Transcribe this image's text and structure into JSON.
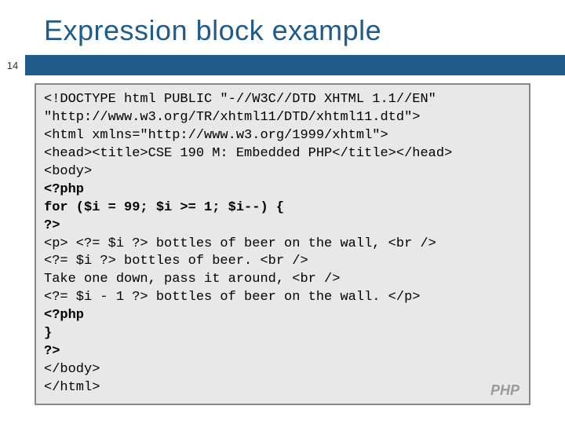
{
  "title": "Expression block example",
  "page_number": "14",
  "lang_label": "PHP",
  "code": {
    "l1": "<!DOCTYPE html PUBLIC \"-//W3C//DTD XHTML 1.1//EN\"",
    "l2": "\"http://www.w3.org/TR/xhtml11/DTD/xhtml11.dtd\">",
    "l3": "<html xmlns=\"http://www.w3.org/1999/xhtml\">",
    "l4": "<head><title>CSE 190 M: Embedded PHP</title></head>",
    "l5": "<body>",
    "l6": "<?php",
    "l7": "for ($i = 99; $i >= 1; $i--) {",
    "l8": "?>",
    "l9": "<p> <?= $i ?> bottles of beer on the wall, <br />",
    "l10": "<?= $i ?> bottles of beer. <br />",
    "l11": "Take one down, pass it around, <br />",
    "l12": "<?= $i - 1 ?> bottles of beer on the wall. </p>",
    "l13": "<?php",
    "l14": "}",
    "l15": "?>",
    "l16": "</body>",
    "l17": "</html>"
  }
}
